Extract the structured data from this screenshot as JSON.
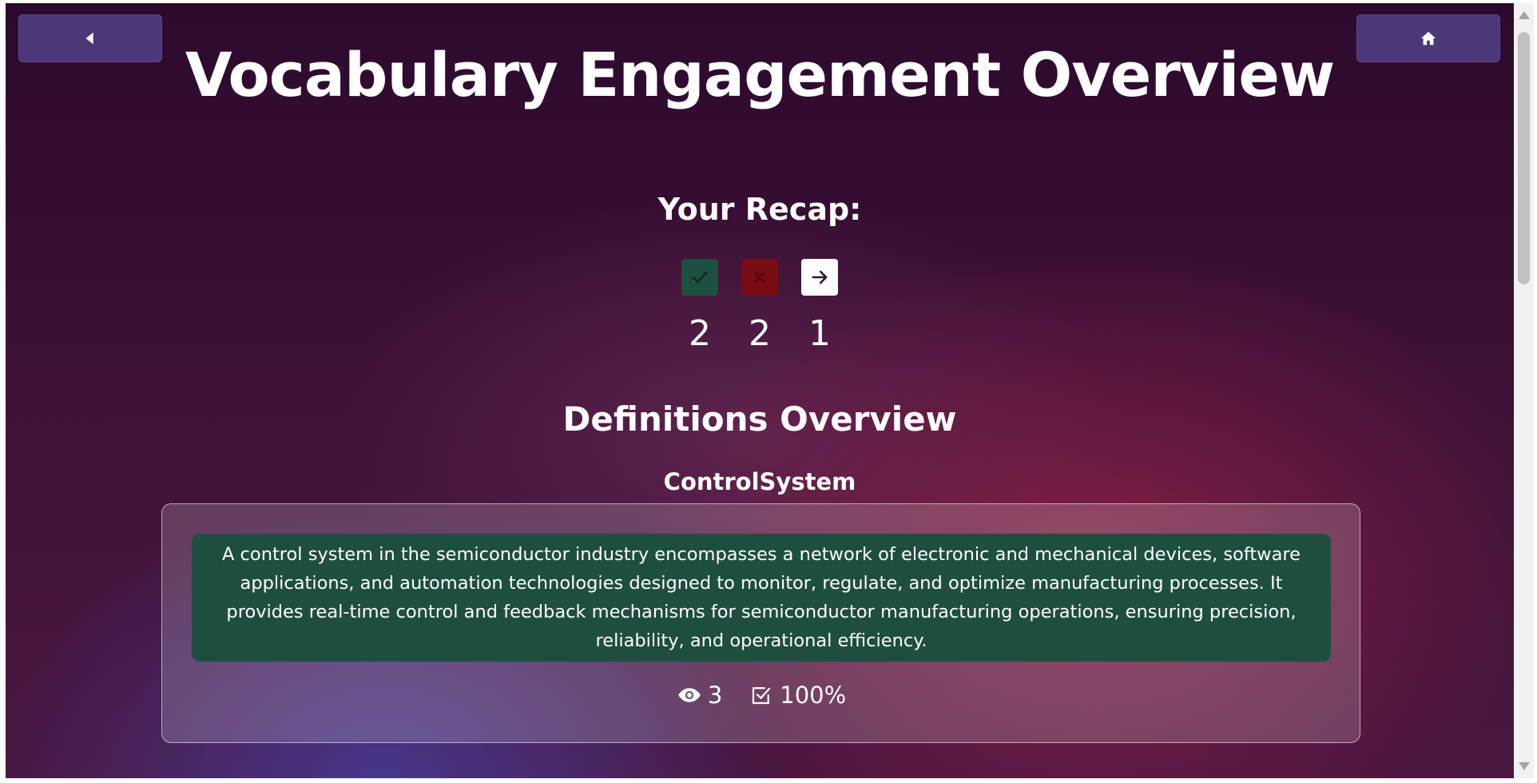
{
  "header": {
    "title": "Vocabulary Engagement Overview",
    "back_icon": "caret-left-icon",
    "home_icon": "home-icon"
  },
  "recap": {
    "heading": "Your Recap:",
    "stats": [
      {
        "icon": "check-icon",
        "count": "2",
        "color": "#1e5040"
      },
      {
        "icon": "x-icon",
        "count": "2",
        "color": "#7a0c14"
      },
      {
        "icon": "arrow-right-icon",
        "count": "1",
        "color": "#ffffff"
      }
    ]
  },
  "definitions": {
    "heading": "Definitions Overview",
    "items": [
      {
        "term": "ControlSystem",
        "definition": "A control system in the semiconductor industry encompasses a network of electronic and mechanical devices, software applications, and automation technologies designed to monitor, regulate, and optimize manufacturing processes. It provides real-time control and feedback mechanisms for semiconductor manufacturing operations, ensuring precision, reliability, and operational efficiency.",
        "views": "3",
        "accuracy": "100%"
      }
    ]
  },
  "colors": {
    "button_bg": "#4a3878",
    "definition_bg": "#1e4e40"
  }
}
